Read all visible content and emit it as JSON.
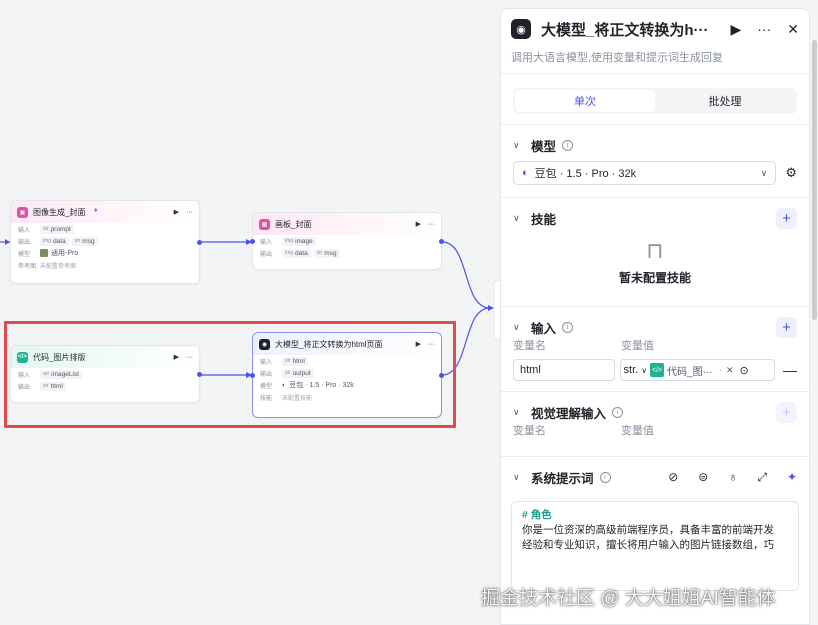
{
  "canvas": {
    "nodes": {
      "image_gen": {
        "title": "图像生成_封面",
        "input_label": "输入",
        "input_type": "str",
        "input_name": "prompt",
        "output_label": "输出",
        "output_type1": "img",
        "output_name1": "data",
        "output_type2": "str",
        "output_name2": "msg",
        "model_label": "模型",
        "model_value": "通用-Pro",
        "ref_label": "参考图",
        "ref_value": "未配置参考图"
      },
      "canvas_cover": {
        "title": "画板_封面",
        "input_label": "输入",
        "input_type": "img",
        "input_name": "image",
        "output_label": "输出",
        "output_type1": "img",
        "output_name1": "data",
        "output_type2": "str",
        "output_name2": "msg"
      },
      "code_layout": {
        "title": "代码_图片排版",
        "input_label": "输入",
        "input_type": "arr",
        "input_name": "imageList",
        "output_label": "输出",
        "output_type": "str",
        "output_name": "html"
      },
      "llm_html": {
        "title": "大模型_将正文转换为html页面",
        "input_label": "输入",
        "input_type": "str",
        "input_name": "html",
        "output_label": "输出",
        "output_type": "str",
        "output_name": "output",
        "model_label": "模型",
        "model_value": "豆包 · 1.5 · Pro · 32k",
        "skill_label": "技能",
        "skill_value": "未配置技能"
      }
    }
  },
  "panel": {
    "title": "大模型_将正文转换为h···",
    "description": "调用大语言模型,使用变量和提示词生成回复",
    "tabs": [
      "单次",
      "批处理"
    ],
    "model": {
      "title": "模型",
      "selected": "豆包 · 1.5 · Pro · 32k"
    },
    "skills": {
      "title": "技能",
      "empty_text": "暂未配置技能"
    },
    "input": {
      "title": "输入",
      "col_name": "变量名",
      "col_value": "变量值",
      "var_name": "html",
      "var_type": "str.",
      "var_ref": "代码_图···",
      "var_ref_suffix": "·"
    },
    "vision": {
      "title": "视觉理解输入",
      "col_name": "变量名",
      "col_value": "变量值"
    },
    "system_prompt": {
      "title": "系统提示词",
      "heading": "# 角色",
      "line1": "你是一位资深的高级前端程序员，具备丰富的前端开发",
      "line2": "经验和专业知识，擅长将用户输入的图片链接数组，巧"
    }
  },
  "watermark": "掘金技术社区 @ 大大姐姐AI智能体",
  "colors": {
    "accent": "#4d53e8",
    "highlight": "#e24b4b"
  }
}
